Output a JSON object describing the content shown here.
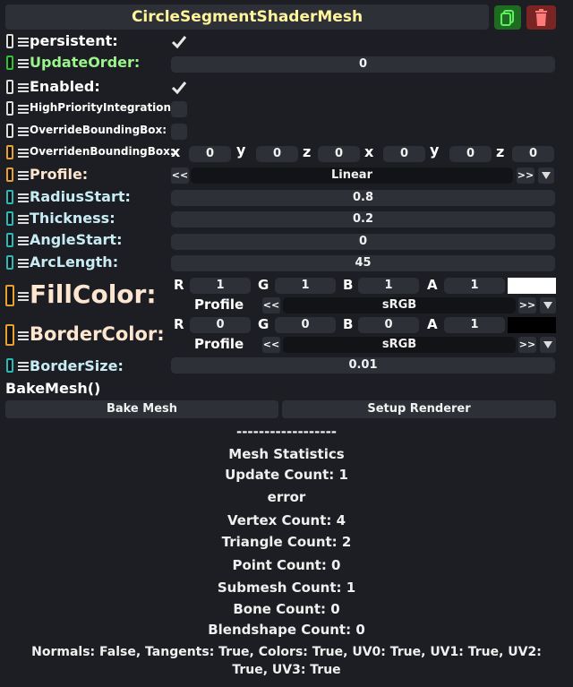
{
  "component": {
    "title": "CircleSegmentShaderMesh"
  },
  "fields": {
    "persistent": {
      "label": "persistent:",
      "checked": true
    },
    "update_order": {
      "label": "UpdateOrder:",
      "value": "0"
    },
    "enabled": {
      "label": "Enabled:",
      "checked": true
    },
    "high_priority": {
      "label": "HighPriorityIntegration:",
      "checked": false
    },
    "override_bbox": {
      "label": "OverrideBoundingBox:",
      "checked": false
    },
    "overriden_bbox": {
      "label": "OverridenBoundingBox:",
      "axes": [
        "x",
        "y",
        "z",
        "x",
        "y",
        "z"
      ],
      "values": [
        "0",
        "0",
        "0",
        "0",
        "0",
        "0"
      ]
    },
    "profile": {
      "label": "Profile:",
      "value": "Linear",
      "prev": "<<",
      "next": ">>"
    },
    "radius_start": {
      "label": "RadiusStart:",
      "value": "0.8"
    },
    "thickness": {
      "label": "Thickness:",
      "value": "0.2"
    },
    "angle_start": {
      "label": "AngleStart:",
      "value": "0"
    },
    "arc_length": {
      "label": "ArcLength:",
      "value": "45"
    },
    "fill_color": {
      "label": "FillColor:",
      "channels": [
        "R",
        "G",
        "B",
        "A"
      ],
      "values": [
        "1",
        "1",
        "1",
        "1"
      ],
      "swatch": "#ffffff",
      "profile_label": "Profile",
      "profile_value": "sRGB"
    },
    "border_color": {
      "label": "BorderColor:",
      "channels": [
        "R",
        "G",
        "B",
        "A"
      ],
      "values": [
        "0",
        "0",
        "0",
        "1"
      ],
      "swatch": "#000000",
      "profile_label": "Profile",
      "profile_value": "sRGB"
    },
    "border_size": {
      "label": "BorderSize:",
      "value": "0.01"
    }
  },
  "bake": {
    "method_label": "BakeMesh()",
    "bake_button": "Bake Mesh",
    "setup_button": "Setup Renderer"
  },
  "stats": {
    "divider": "------------------",
    "title": "Mesh Statistics",
    "update_count": "Update Count: 1",
    "error": "error",
    "vertex_count": "Vertex Count: 4",
    "triangle_count": "Triangle Count: 2",
    "point_count": "Point Count: 0",
    "submesh_count": "Submesh Count: 1",
    "bone_count": "Bone Count: 0",
    "blendshape_count": "Blendshape Count: 0",
    "attributes_line1": "Normals: False, Tangents: True, Colors: True, UV0: True, UV1: True, UV2:",
    "attributes_line2": "True, UV3: True"
  },
  "colors": {
    "title_text": "#fff59a",
    "label_bool": "#ffffff",
    "label_int": "#9af58a",
    "label_float": "#c8ecf4",
    "label_color": "#fde6cf",
    "plug_green": "#2fc12f",
    "plug_cyan": "#2ab8b8",
    "plug_orange": "#e8a030",
    "plug_white": "#dddddd"
  },
  "icons": {
    "duplicate": "copy-icon",
    "delete": "trash-icon",
    "check": "checkmark-icon",
    "dropdown": "triangle-down-icon"
  }
}
